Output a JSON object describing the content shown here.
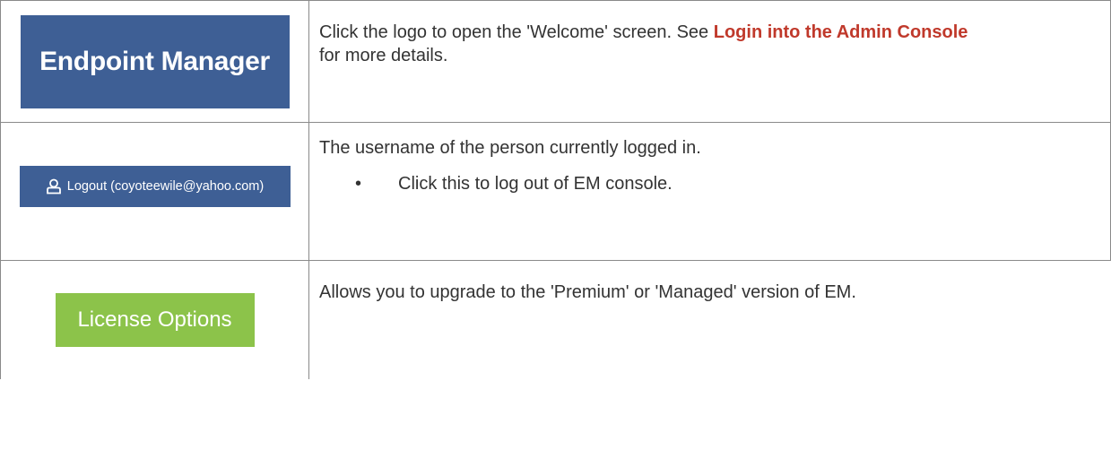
{
  "rows": [
    {
      "logo_text": "Endpoint Manager",
      "desc_before": "Click the logo to open the 'Welcome' screen. See ",
      "link_text": "Login into the Admin Console",
      "desc_after": "for more details."
    },
    {
      "button_text": "Logout (coyoteewile@yahoo.com)",
      "icon": "user-icon",
      "desc": "The username of the person currently logged in.",
      "bullet_symbol": "•",
      "bullet_text": "Click this to log out of EM console."
    },
    {
      "button_text": "License Options",
      "desc": "Allows you to upgrade to the 'Premium' or 'Managed' version of EM."
    }
  ],
  "colors": {
    "logo_bg": "#3e5f95",
    "license_bg": "#8cc34a",
    "link": "#c0392b",
    "border": "#8a8a8a"
  }
}
